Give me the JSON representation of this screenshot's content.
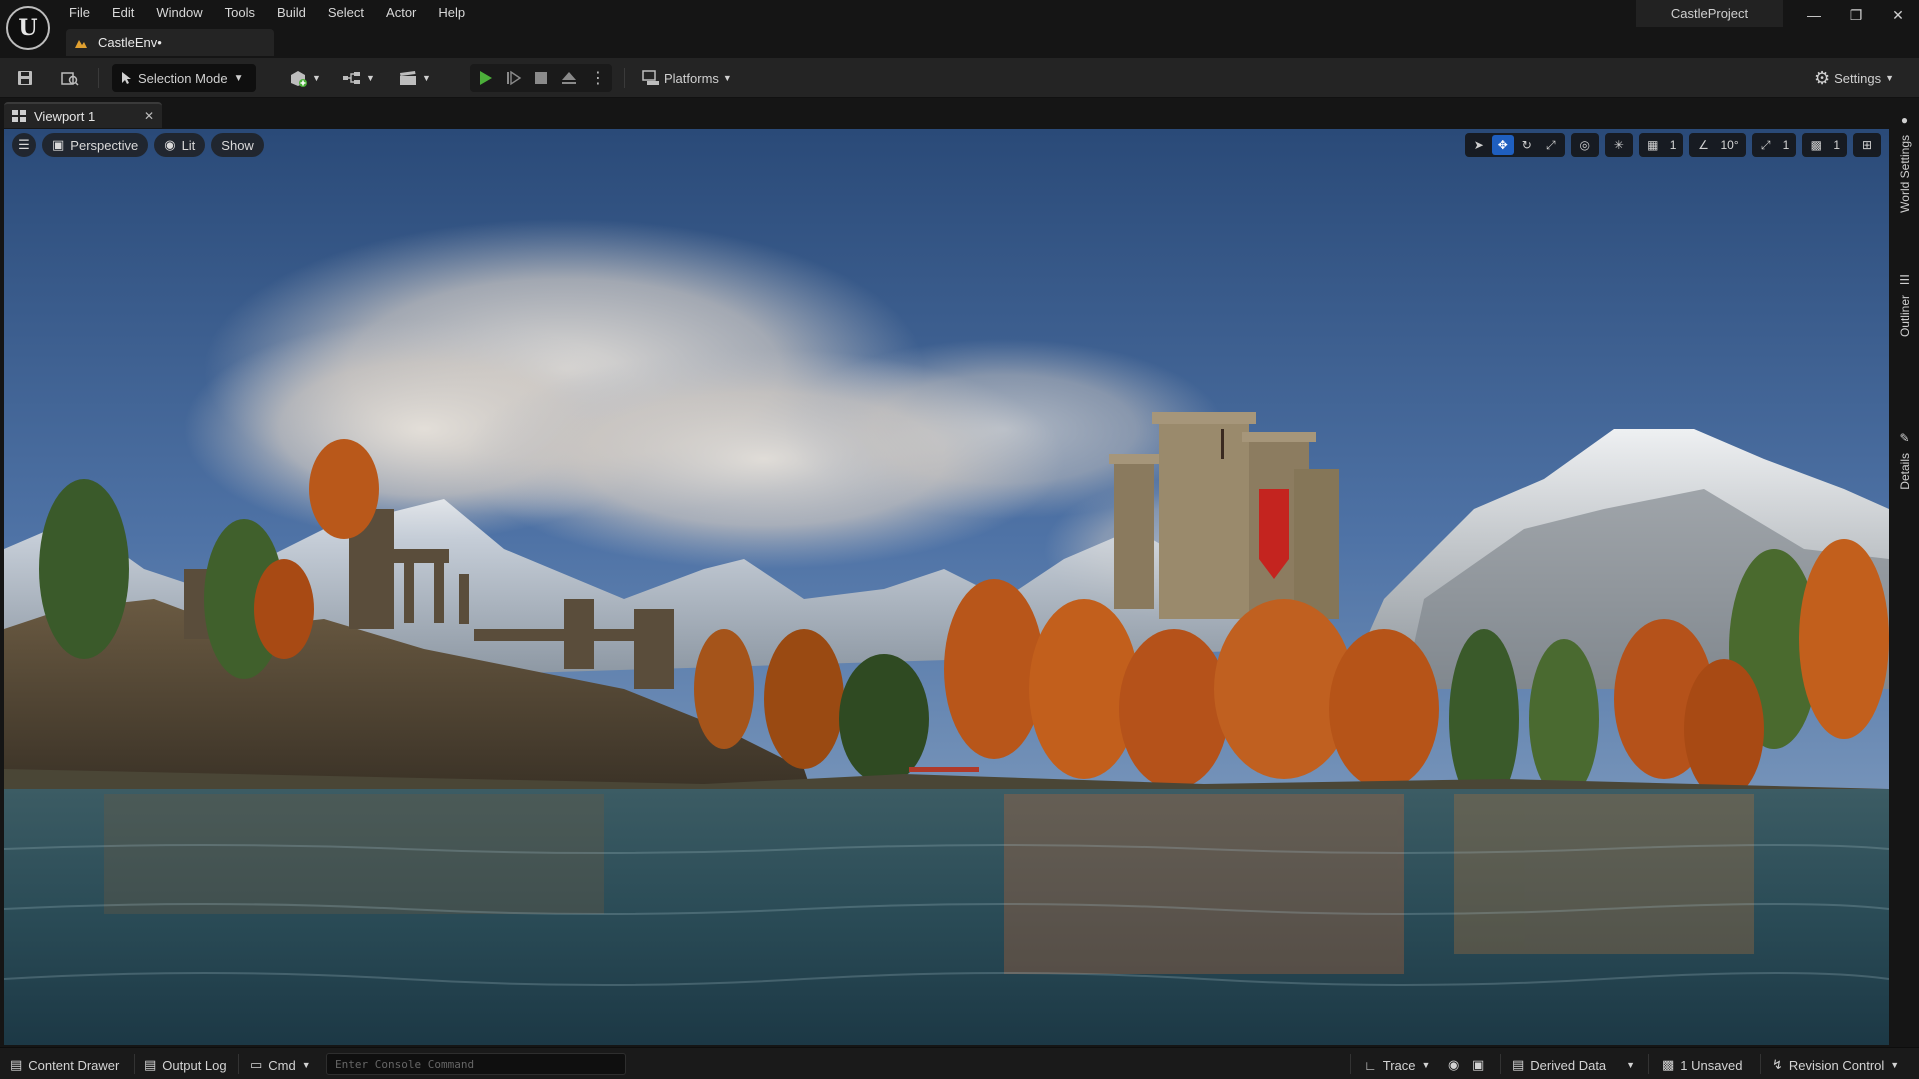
{
  "app": {
    "menu": [
      "File",
      "Edit",
      "Window",
      "Tools",
      "Build",
      "Select",
      "Actor",
      "Help"
    ],
    "level_tab": "CastleEnv•",
    "project_name": "CastleProject",
    "window_controls": [
      "minimize-icon",
      "restore-icon",
      "close-icon"
    ]
  },
  "toolbar": {
    "selection_mode": "Selection Mode",
    "platforms": "Platforms",
    "settings": "Settings",
    "icons": [
      "save-icon",
      "content-browser-icon",
      "add-actor-icon",
      "blueprint-icon",
      "cinematics-icon",
      "play-icon",
      "advance-frame-icon",
      "stop-icon",
      "eject-icon",
      "more-options-icon"
    ]
  },
  "viewport": {
    "tab_label": "Viewport 1",
    "view_mode": "Perspective",
    "lighting_mode": "Lit",
    "show_label": "Show",
    "grid_snap": "1",
    "rotation_snap": "10°",
    "scale_snap": "1",
    "camera_speed": "1",
    "active_tool": "translate"
  },
  "side_tabs": [
    "World Settings",
    "Outliner",
    "Details"
  ],
  "statusbar": {
    "content_drawer": "Content Drawer",
    "output_log": "Output Log",
    "cmd": "Cmd",
    "console_placeholder": "Enter Console Command",
    "trace": "Trace",
    "derived_data": "Derived Data",
    "unsaved": "1 Unsaved",
    "revision_control": "Revision Control"
  },
  "colors": {
    "accent": "#1f5fbf",
    "play_green": "#4caf3a",
    "banner_red": "#c4241f"
  }
}
